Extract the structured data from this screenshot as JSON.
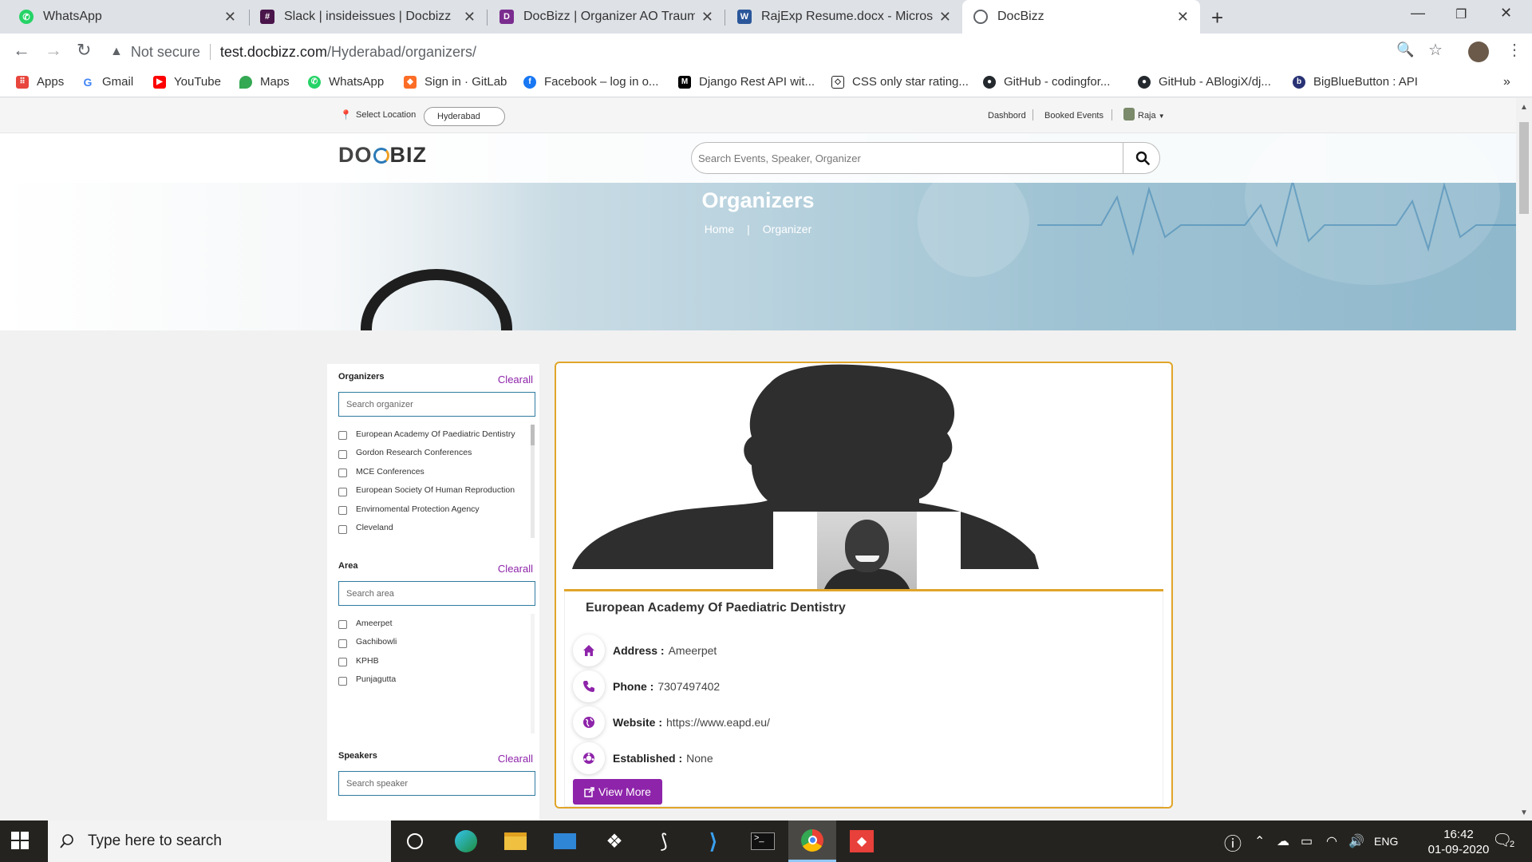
{
  "browser": {
    "tabs": [
      {
        "title": "WhatsApp",
        "icon": "whatsapp-icon",
        "color": "#25d366"
      },
      {
        "title": "Slack | insideissues | Docbizz",
        "icon": "slack-icon",
        "color": "#4a154b"
      },
      {
        "title": "DocBizz | Organizer AO Trauma",
        "icon": "docbizz-icon",
        "color": "#7b2c8f"
      },
      {
        "title": "RajExp Resume.docx - Microsoft",
        "icon": "word-icon",
        "color": "#2b579a"
      },
      {
        "title": "DocBizz",
        "icon": "globe-icon",
        "color": "#5f6368"
      }
    ],
    "active_tab": 4,
    "address": {
      "security": "Not secure",
      "host": "test.docbizz.com",
      "path": "/Hyderabad/organizers/"
    },
    "bookmarks": [
      {
        "label": "Apps",
        "icon": "apps-grid-icon",
        "color": "#e8453c"
      },
      {
        "label": "Gmail",
        "icon": "google-icon",
        "color": "#4285f4"
      },
      {
        "label": "YouTube",
        "icon": "youtube-icon",
        "color": "#ff0000"
      },
      {
        "label": "Maps",
        "icon": "maps-pin-icon",
        "color": "#34a853"
      },
      {
        "label": "WhatsApp",
        "icon": "whatsapp-icon",
        "color": "#25d366"
      },
      {
        "label": "Sign in · GitLab",
        "icon": "gitlab-icon",
        "color": "#fc6d26"
      },
      {
        "label": "Facebook – log in o...",
        "icon": "facebook-icon",
        "color": "#1877f2"
      },
      {
        "label": "Django Rest API wit...",
        "icon": "medium-icon",
        "color": "#000000"
      },
      {
        "label": "CSS only star rating...",
        "icon": "codepen-icon",
        "color": "#222222"
      },
      {
        "label": "GitHub - codingfor...",
        "icon": "github-icon",
        "color": "#24292e"
      },
      {
        "label": "GitHub - ABlogiX/dj...",
        "icon": "github-icon",
        "color": "#24292e"
      },
      {
        "label": "BigBlueButton : API",
        "icon": "bigbluebutton-icon",
        "color": "#283274"
      }
    ]
  },
  "site": {
    "location_label": "Select Location",
    "location_value": "Hyderabad",
    "top_links": [
      "Dashbord",
      "Booked Events"
    ],
    "user_name": "Raja",
    "logo_text_left": "DO",
    "logo_text_right": "BIZ",
    "search_placeholder": "Search Events, Speaker, Organizer",
    "hero_title": "Organizers",
    "breadcrumb": {
      "home": "Home",
      "separator": "|",
      "current": "Organizer"
    },
    "accent": "#8e24aa",
    "card_border": "#e0a52a"
  },
  "filters": {
    "clear_label": "Clearall",
    "organizers": {
      "title": "Organizers",
      "placeholder": "Search organizer",
      "items": [
        "European Academy Of Paediatric Dentistry",
        "Gordon Research Conferences",
        "MCE Conferences",
        "European Society Of Human Reproduction",
        "Envirnomental Protection Agency",
        "Cleveland"
      ]
    },
    "area": {
      "title": "Area",
      "placeholder": "Search area",
      "items": [
        "Ameerpet",
        "Gachibowli",
        "KPHB",
        "Punjagutta"
      ]
    },
    "speakers": {
      "title": "Speakers",
      "placeholder": "Search speaker"
    }
  },
  "organizer_card": {
    "name": "European Academy Of Paediatric Dentistry",
    "rows": [
      {
        "label": "Address :",
        "value": "Ameerpet",
        "icon": "home-icon"
      },
      {
        "label": "Phone :",
        "value": "7307497402",
        "icon": "phone-icon"
      },
      {
        "label": "Website :",
        "value": "https://www.eapd.eu/",
        "icon": "globe-icon"
      },
      {
        "label": "Established :",
        "value": "None",
        "icon": "award-icon"
      }
    ],
    "button_label": "View More"
  },
  "taskbar": {
    "search_placeholder": "Type here to search",
    "apps": [
      "cortana-icon",
      "edge-icon",
      "file-explorer-icon",
      "mail-icon",
      "dropbox-icon",
      "cursor-app-icon",
      "vscode-icon",
      "terminal-icon",
      "chrome-icon",
      "anydesk-icon"
    ],
    "active_app": 8,
    "language": "ENG",
    "time": "16:42",
    "date": "01-09-2020",
    "notification_count": "2"
  }
}
